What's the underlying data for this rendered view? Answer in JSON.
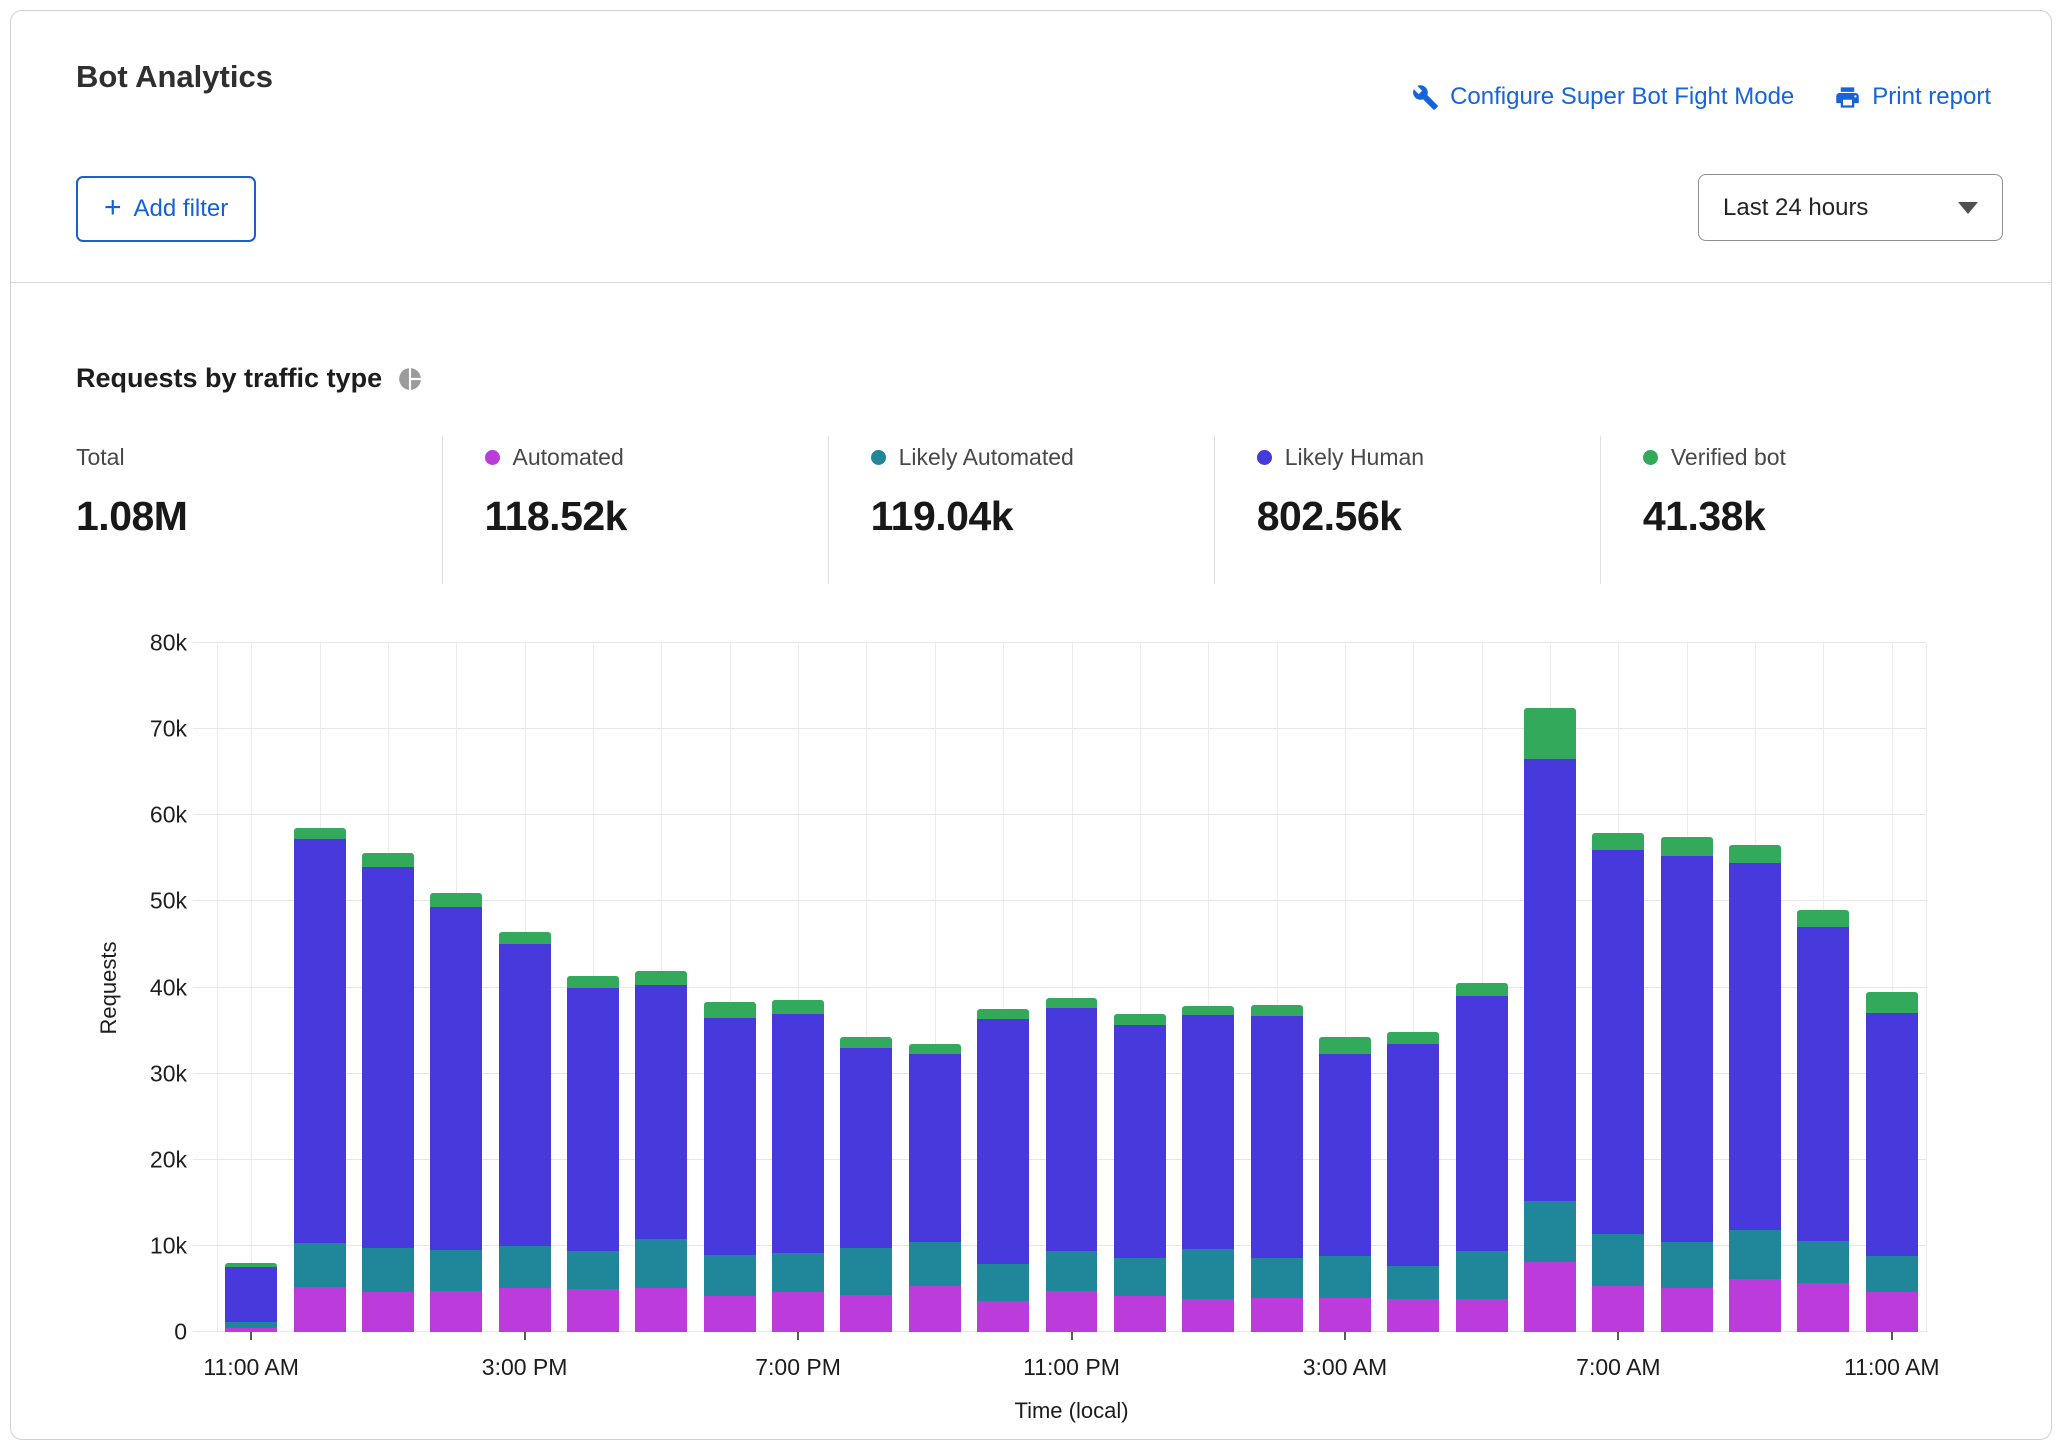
{
  "header": {
    "title": "Bot Analytics",
    "configure_link": "Configure Super Bot Fight Mode",
    "print_link": "Print report",
    "add_filter_label": "Add filter",
    "add_filter_plus": "+",
    "time_range_selected": "Last 24 hours"
  },
  "section": {
    "title": "Requests by traffic type"
  },
  "icons": {
    "configure": "wrench-icon",
    "print": "printer-icon",
    "add_filter": "plus-icon",
    "time_range": "chevron-down-icon",
    "section_title": "pie-chart-icon"
  },
  "colors": {
    "link_blue": "#1663dc",
    "automated": "#BB3BDB",
    "likely_automated": "#20879B",
    "likely_human": "#4739DB",
    "verified_bot": "#33A95C",
    "gridline": "#e7e7e7"
  },
  "stats": [
    {
      "label": "Total",
      "value": "1.08M",
      "color": null
    },
    {
      "label": "Automated",
      "value": "118.52k",
      "color": "#BB3BDB"
    },
    {
      "label": "Likely Automated",
      "value": "119.04k",
      "color": "#20879B"
    },
    {
      "label": "Likely Human",
      "value": "802.56k",
      "color": "#4739DB"
    },
    {
      "label": "Verified bot",
      "value": "41.38k",
      "color": "#33A95C"
    }
  ],
  "chart_data": {
    "type": "bar",
    "stacked": true,
    "title": "Requests by traffic type",
    "xlabel": "Time (local)",
    "ylabel": "Requests",
    "ylim": [
      0,
      80000
    ],
    "grid": true,
    "y_ticks": [
      "0",
      "10k",
      "20k",
      "30k",
      "40k",
      "50k",
      "60k",
      "70k",
      "80k"
    ],
    "x_tick_labels": [
      "11:00 AM",
      "3:00 PM",
      "7:00 PM",
      "11:00 PM",
      "3:00 AM",
      "7:00 AM",
      "11:00 AM"
    ],
    "x_label_every": 4,
    "categories": [
      "11:00 AM",
      "12:00 PM",
      "1:00 PM",
      "2:00 PM",
      "3:00 PM",
      "4:00 PM",
      "5:00 PM",
      "6:00 PM",
      "7:00 PM",
      "8:00 PM",
      "9:00 PM",
      "10:00 PM",
      "11:00 PM",
      "12:00 AM",
      "1:00 AM",
      "2:00 AM",
      "3:00 AM",
      "4:00 AM",
      "5:00 AM",
      "6:00 AM",
      "7:00 AM",
      "8:00 AM",
      "9:00 AM",
      "10:00 AM",
      "11:00 AM"
    ],
    "series": [
      {
        "name": "Automated",
        "color": "#BB3BDB",
        "values": [
          500,
          5200,
          4700,
          4800,
          5100,
          5000,
          5100,
          4200,
          4600,
          4300,
          5400,
          3600,
          4800,
          4200,
          3800,
          4000,
          3900,
          3800,
          3800,
          8100,
          5300,
          5100,
          6200,
          5700,
          4700
        ]
      },
      {
        "name": "Likely Automated",
        "color": "#20879B",
        "values": [
          700,
          5100,
          5000,
          4700,
          4900,
          4400,
          5700,
          4800,
          4600,
          5500,
          5000,
          4300,
          4600,
          4400,
          5800,
          4600,
          4900,
          3900,
          5600,
          7100,
          6100,
          5300,
          5700,
          4900,
          4100
        ]
      },
      {
        "name": "Likely Human",
        "color": "#4739DB",
        "values": [
          6400,
          47000,
          44300,
          39800,
          35000,
          30500,
          29500,
          27500,
          27700,
          23200,
          21900,
          28400,
          28200,
          27100,
          27200,
          28100,
          23500,
          25700,
          29600,
          51300,
          44600,
          44900,
          42600,
          36400,
          28200
        ]
      },
      {
        "name": "Verified bot",
        "color": "#33A95C",
        "values": [
          400,
          1200,
          1600,
          1700,
          1400,
          1400,
          1600,
          1800,
          1700,
          1200,
          1200,
          1200,
          1200,
          1200,
          1100,
          1300,
          1900,
          1400,
          1500,
          6000,
          2000,
          2200,
          2000,
          2000,
          2500
        ]
      }
    ]
  }
}
